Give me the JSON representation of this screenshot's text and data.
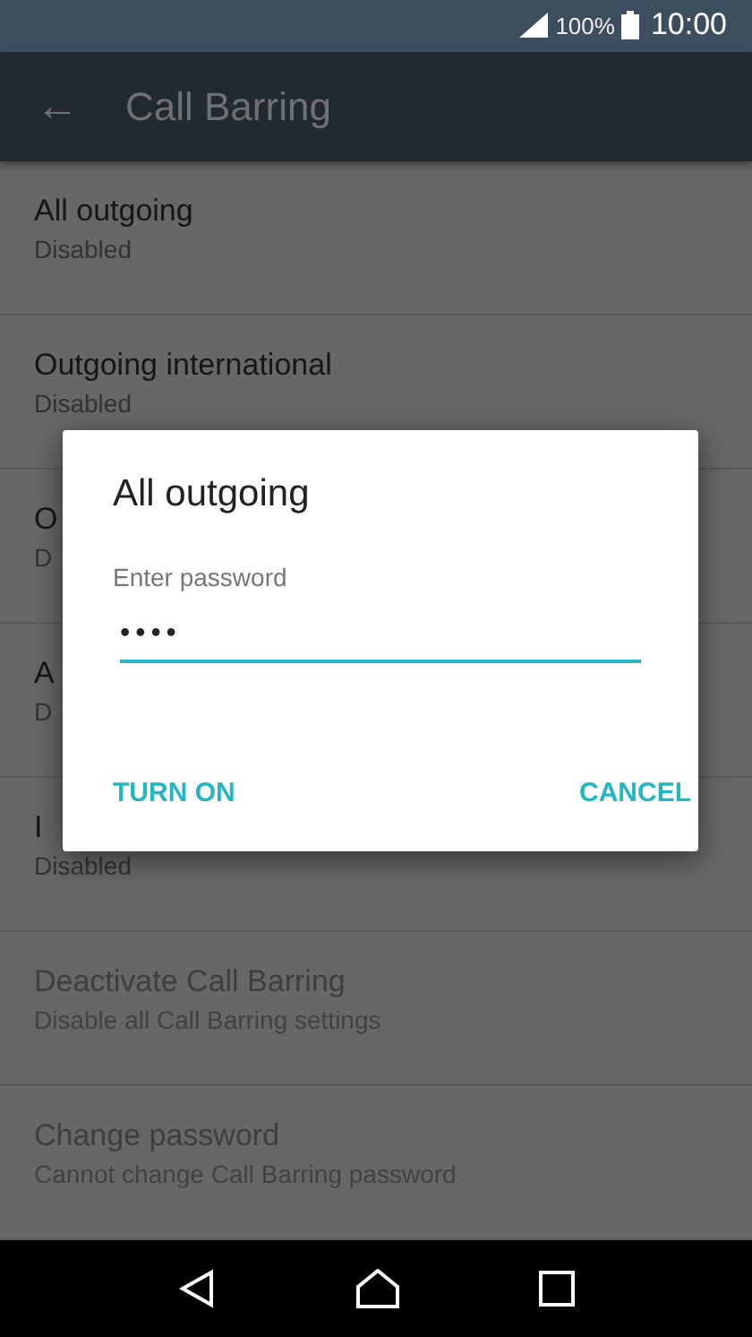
{
  "status_bar": {
    "battery": "100%",
    "time": "10:00"
  },
  "app_bar": {
    "back": "←",
    "title": "Call Barring"
  },
  "list": [
    {
      "title": "All outgoing",
      "subtitle": "Disabled",
      "disabled": false
    },
    {
      "title": "Outgoing international",
      "subtitle": "Disabled",
      "disabled": false
    },
    {
      "title": "O",
      "subtitle": "D",
      "disabled": false
    },
    {
      "title": "A",
      "subtitle": "D",
      "disabled": false
    },
    {
      "title": "I",
      "subtitle": "Disabled",
      "disabled": false
    },
    {
      "title": "Deactivate Call Barring",
      "subtitle": "Disable all Call Barring settings",
      "disabled": true
    },
    {
      "title": "Change password",
      "subtitle": "Cannot change Call Barring password",
      "disabled": true
    }
  ],
  "dialog": {
    "title": "All outgoing",
    "field": {
      "label": "Enter password",
      "value": "••••"
    },
    "buttons": [
      "TURN ON",
      "CANCEL"
    ]
  }
}
